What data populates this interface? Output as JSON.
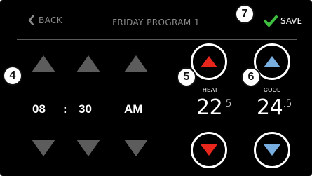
{
  "header": {
    "back_label": "BACK",
    "title": "FRIDAY PROGRAM 1",
    "save_label": "SAVE"
  },
  "time": {
    "hour": "08",
    "separator": ":",
    "minute": "30",
    "period": "AM"
  },
  "heat": {
    "label": "HEAT",
    "value_main": "22",
    "value_decimal": ".5"
  },
  "cool": {
    "label": "COOL",
    "value_main": "24",
    "value_decimal": ".5"
  },
  "badges": {
    "time_controls": "4",
    "heat_up": "5",
    "cool_up": "6",
    "save": "7"
  },
  "colors": {
    "background": "#000000",
    "arrow_gray": "#5c5c5c",
    "heat_red": "#e8261c",
    "cool_blue": "#79aee0",
    "save_green": "#3fbf3f"
  },
  "icons": [
    "chevron-left-icon",
    "check-icon",
    "up-arrow-icon",
    "down-arrow-icon"
  ]
}
